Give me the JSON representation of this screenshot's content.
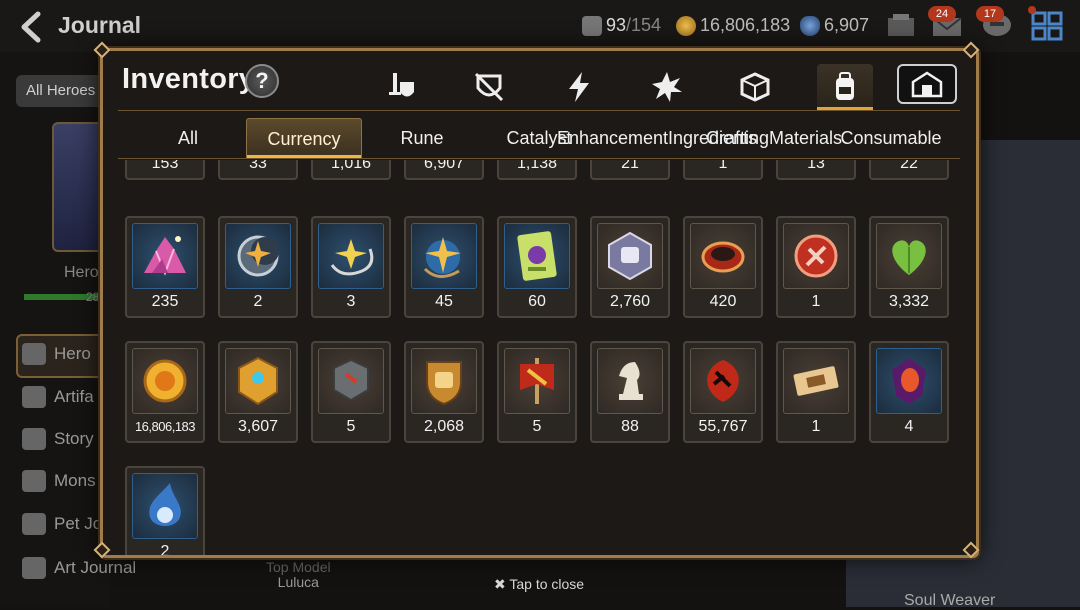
{
  "background": {
    "title": "Journal",
    "stamina": "93",
    "stamina_max": "/154",
    "gold": "16,806,183",
    "skystones": "6,907",
    "mail_badge": "24",
    "chat_badge": "17",
    "all_heroes": "All Heroes",
    "hero_label": "Hero",
    "hero_count": "28",
    "menu": [
      "Hero",
      "Artifa",
      "Story",
      "Mons",
      "Pet Jo",
      "Art Journal"
    ],
    "top_model_label": "Top Model",
    "top_model_name": "Luluca",
    "soul_weaver": "Soul Weaver"
  },
  "inventory": {
    "title": "Inventory",
    "help": "?",
    "category_icons": [
      "sword-shield-icon",
      "broken-shield-icon",
      "lightning-icon",
      "starburst-icon",
      "dice-icon",
      "backpack-icon"
    ],
    "active_category": 5,
    "sub_tabs": [
      "All",
      "Currency",
      "Rune",
      "Catalyst",
      "Enhancement Ingredients",
      "Crafting Materials",
      "Consumable"
    ],
    "active_sub_tab": 1,
    "close_hint": "Tap to close",
    "rows": [
      [
        {
          "icon": "item-icon",
          "count": "153",
          "style": "blue"
        },
        {
          "icon": "item-icon",
          "count": "33",
          "style": "blue"
        },
        {
          "icon": "item-icon",
          "count": "1,016",
          "style": "blue"
        },
        {
          "icon": "item-icon",
          "count": "6,907",
          "style": "blue"
        },
        {
          "icon": "item-icon",
          "count": "1,138",
          "style": "blue"
        },
        {
          "icon": "item-icon",
          "count": "21",
          "style": "blue"
        },
        {
          "icon": "item-icon",
          "count": "1",
          "style": "blue"
        },
        {
          "icon": "item-icon",
          "count": "13",
          "style": "blue"
        },
        {
          "icon": "item-icon",
          "count": "22",
          "style": "blue"
        }
      ],
      [
        {
          "icon": "crystal-pile-icon",
          "count": "235",
          "style": "blue"
        },
        {
          "icon": "moon-star-charm-icon",
          "count": "2",
          "style": "blue"
        },
        {
          "icon": "star-charm-icon",
          "count": "3",
          "style": "blue"
        },
        {
          "icon": "blue-star-charm-icon",
          "count": "45",
          "style": "blue"
        },
        {
          "icon": "card-pack-icon",
          "count": "60",
          "style": "blue"
        },
        {
          "icon": "fist-emblem-icon",
          "count": "2,760",
          "style": "brown"
        },
        {
          "icon": "red-ring-icon",
          "count": "420",
          "style": "brown"
        },
        {
          "icon": "red-badge-icon",
          "count": "1",
          "style": "brown"
        },
        {
          "icon": "green-heart-icon",
          "count": "3,332",
          "style": "brown"
        }
      ],
      [
        {
          "icon": "gold-coin-icon",
          "count": "16,806,183",
          "style": "brown"
        },
        {
          "icon": "gold-medal-icon",
          "count": "3,607",
          "style": "brown"
        },
        {
          "icon": "stone-block-icon",
          "count": "5",
          "style": "brown"
        },
        {
          "icon": "fist-shield-icon",
          "count": "2,068",
          "style": "brown"
        },
        {
          "icon": "war-banner-icon",
          "count": "5",
          "style": "brown"
        },
        {
          "icon": "chess-knight-icon",
          "count": "88",
          "style": "brown"
        },
        {
          "icon": "red-leaf-icon",
          "count": "55,767",
          "style": "brown"
        },
        {
          "icon": "ticket-icon",
          "count": "1",
          "style": "brown"
        },
        {
          "icon": "purple-gem-icon",
          "count": "4",
          "style": "blue"
        }
      ],
      [
        {
          "icon": "blue-flame-icon",
          "count": "2",
          "style": "blue"
        }
      ]
    ]
  },
  "colors": {
    "gold_accent": "#e0a43a",
    "frame": "#a07c4a"
  }
}
